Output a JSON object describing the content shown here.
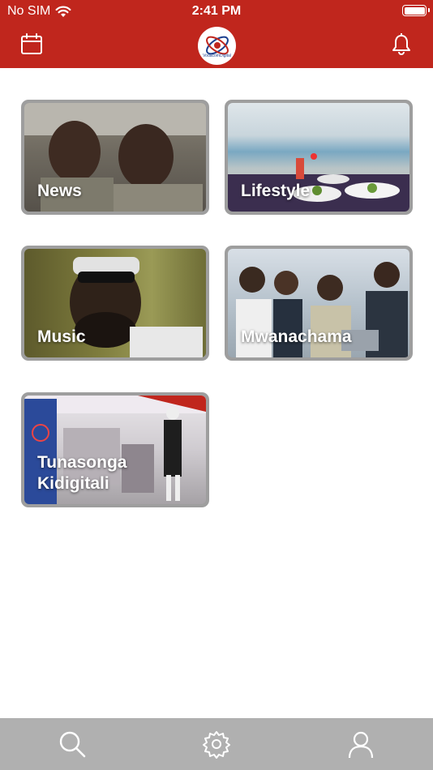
{
  "status_bar": {
    "carrier": "No SIM",
    "time": "2:41 PM"
  },
  "header": {
    "logo_text": "VodacomDigital",
    "calendar_icon": "calendar-icon",
    "bell_icon": "bell-icon"
  },
  "colors": {
    "brand": "#c0261d",
    "tabbar": "#b0b0b0",
    "tile_frame": "#9e9e9e"
  },
  "categories": [
    {
      "label": "News"
    },
    {
      "label": "Lifestyle"
    },
    {
      "label": "Music"
    },
    {
      "label": "Mwanachama"
    },
    {
      "label": "Tunasonga Kidigitali"
    }
  ],
  "tabbar": [
    {
      "icon": "search-icon"
    },
    {
      "icon": "gear-icon"
    },
    {
      "icon": "profile-icon"
    }
  ]
}
